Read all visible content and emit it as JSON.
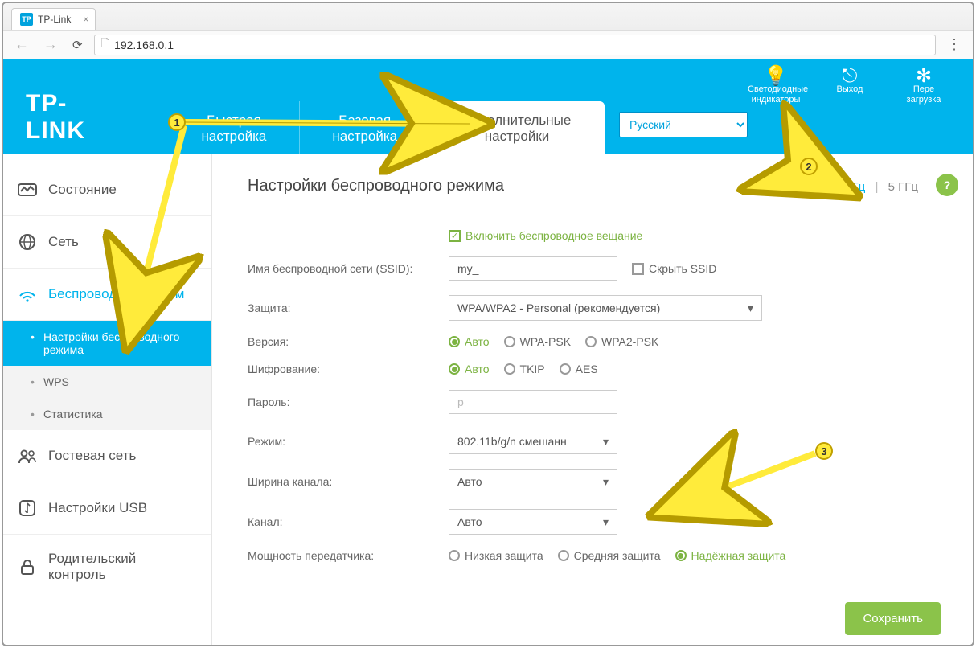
{
  "browser": {
    "tab_title": "TP-Link",
    "url": "192.168.0.1"
  },
  "header": {
    "logo": "TP-LINK",
    "tabs": {
      "quick": "Быстрая настройка",
      "basic": "Базовая настройка",
      "advanced": "Дополнительные настройки"
    },
    "language": "Русский",
    "icons": {
      "led": "Светодиодные индикаторы",
      "logout": "Выход",
      "reboot": "Пере загрузка"
    }
  },
  "sidebar": {
    "status": "Состояние",
    "network": "Сеть",
    "wireless": "Беспроводной режим",
    "wireless_sub": {
      "settings": "Настройки беспроводного режима",
      "wps": "WPS",
      "stats": "Статистика"
    },
    "guest": "Гостевая сеть",
    "usb": "Настройки USB",
    "parental": "Родительский контроль"
  },
  "content": {
    "title": "Настройки беспроводного режима",
    "freq": {
      "g24": "2,4 ГГц",
      "g5": "5 ГГц"
    },
    "enable_broadcast": "Включить беспроводное вещание",
    "ssid_label": "Имя беспроводной сети (SSID):",
    "ssid_value": "my_",
    "hide_ssid": "Скрыть SSID",
    "security_label": "Защита:",
    "security_value": "WPA/WPA2 - Personal (рекомендуется)",
    "version_label": "Версия:",
    "version_opts": {
      "auto": "Авто",
      "wpa": "WPA-PSK",
      "wpa2": "WPA2-PSK"
    },
    "encryption_label": "Шифрование:",
    "encryption_opts": {
      "auto": "Авто",
      "tkip": "TKIP",
      "aes": "AES"
    },
    "password_label": "Пароль:",
    "password_value": "p",
    "mode_label": "Режим:",
    "mode_value": "802.11b/g/n смешанн",
    "width_label": "Ширина канала:",
    "width_value": "Авто",
    "channel_label": "Канал:",
    "channel_value": "Авто",
    "power_label": "Мощность передатчика:",
    "power_opts": {
      "low": "Низкая защита",
      "mid": "Средняя защита",
      "high": "Надёжная защита"
    },
    "save": "Сохранить"
  },
  "annotations": {
    "n1": "1",
    "n2": "2",
    "n3": "3"
  }
}
